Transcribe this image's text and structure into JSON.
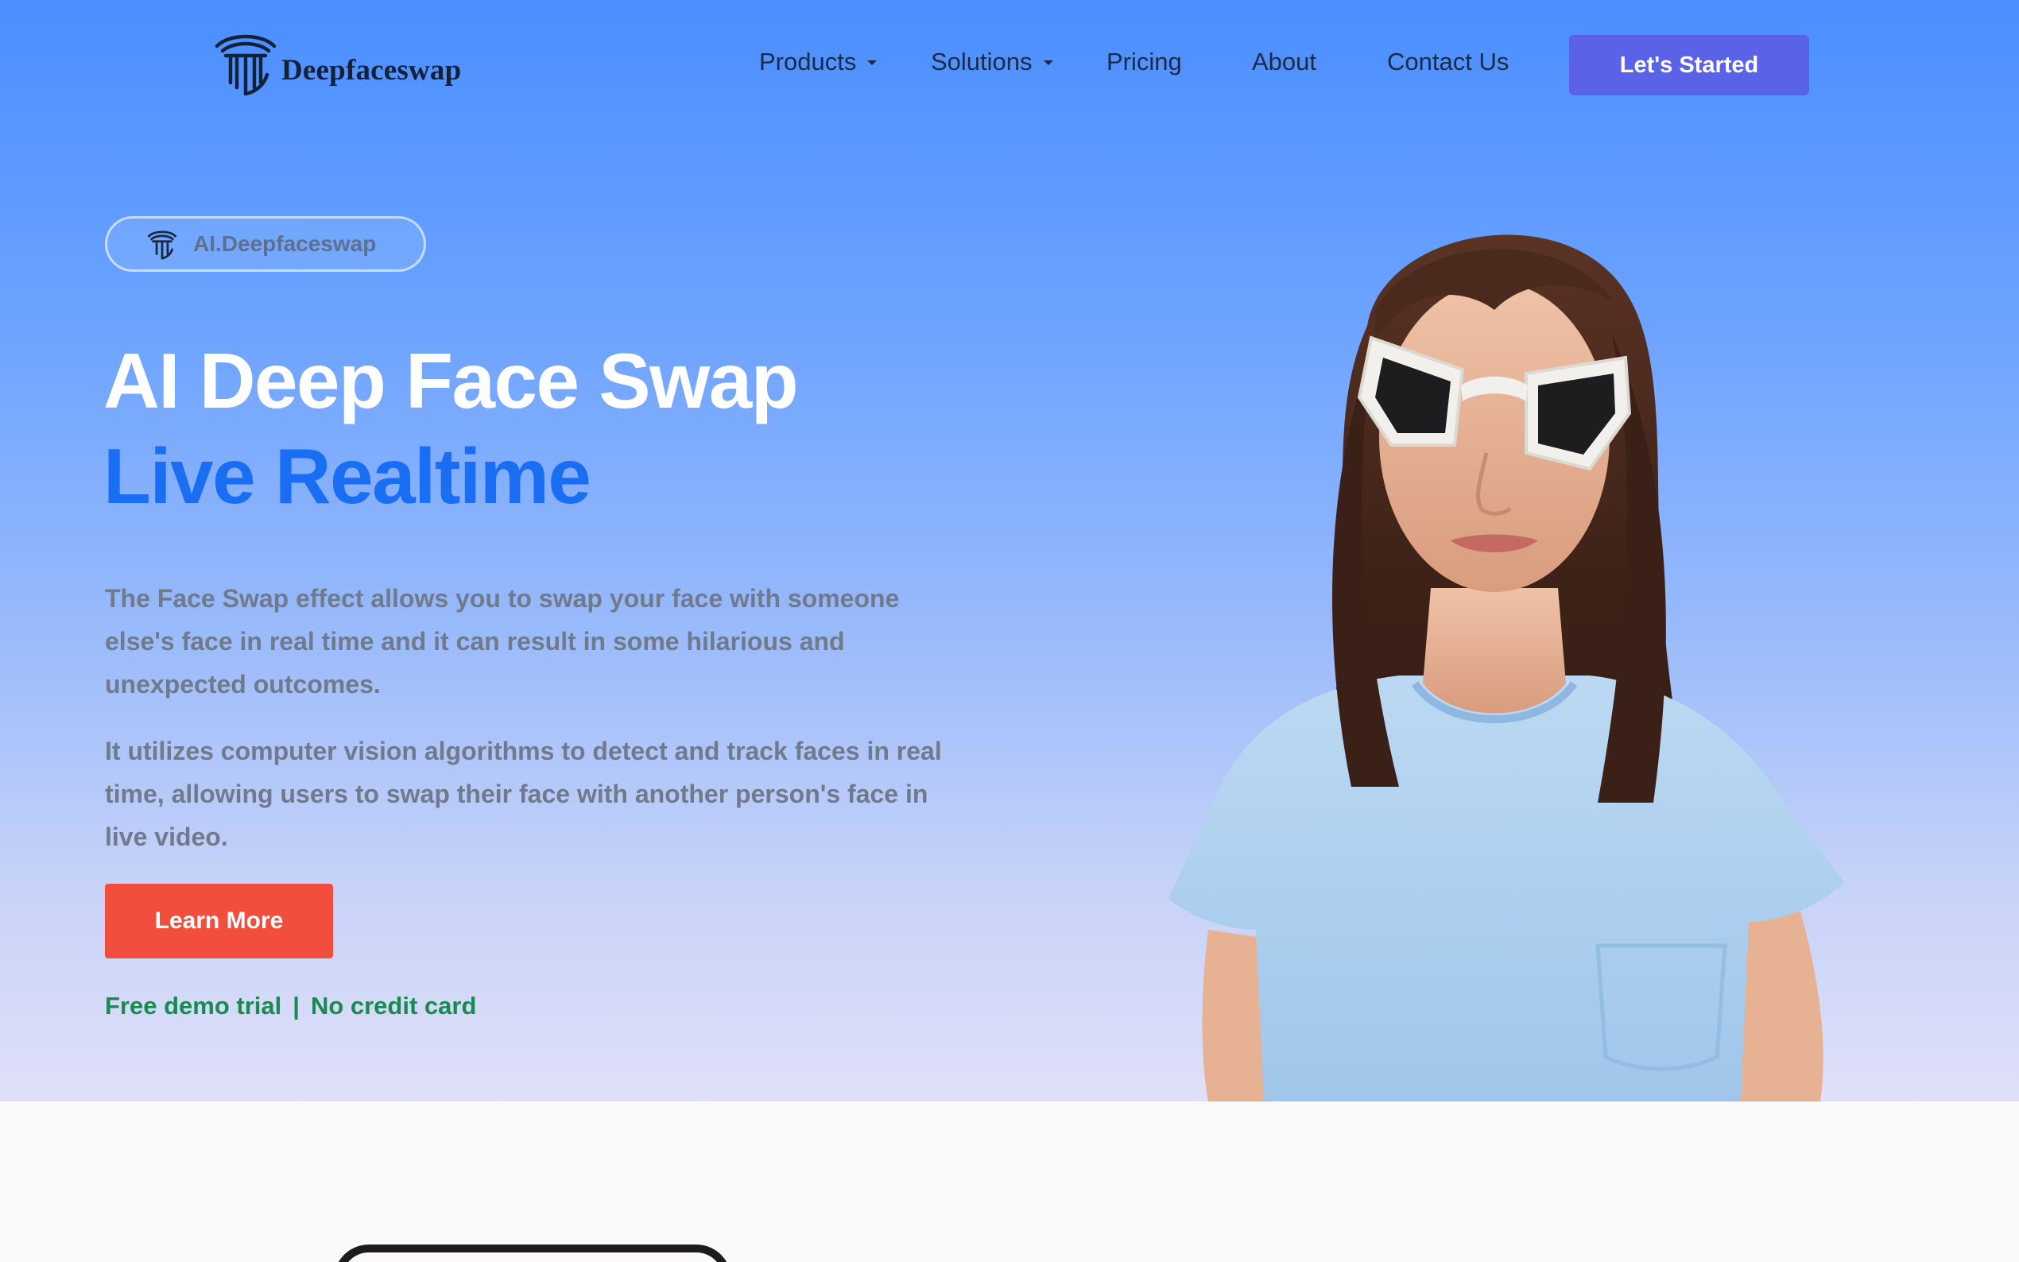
{
  "header": {
    "brand": "Deepfaceswap",
    "logo_icon": "pillar-logo-icon",
    "nav": [
      {
        "label": "Products",
        "has_dropdown": true
      },
      {
        "label": "Solutions",
        "has_dropdown": true
      },
      {
        "label": "Pricing",
        "has_dropdown": false
      },
      {
        "label": "About",
        "has_dropdown": false
      },
      {
        "label": "Contact Us",
        "has_dropdown": false
      }
    ],
    "cta_label": "Let's Started"
  },
  "hero": {
    "badge_label": "AI.Deepfaceswap",
    "title": "AI Deep Face Swap",
    "subtitle": "Live Realtime",
    "paragraphs": [
      "The Face Swap effect allows you to swap your face with someone else's face in real time and it can result in some hilarious and unexpected outcomes.",
      "It utilizes computer vision algorithms to detect and track faces in real time, allowing users to swap their face with another person's face in live video."
    ],
    "learn_more_label": "Learn More",
    "trial_left": "Free demo trial",
    "trial_separator": "|",
    "trial_right": "No credit card"
  },
  "colors": {
    "hero_gradient_top": "#4a8eff",
    "hero_gradient_bottom": "#e0e0f9",
    "cta_primary": "#5a63e8",
    "learn_more": "#f24e3e",
    "subtitle": "#1a6ef4",
    "trial_text": "#188a52",
    "nav_text": "#1e2a45"
  }
}
